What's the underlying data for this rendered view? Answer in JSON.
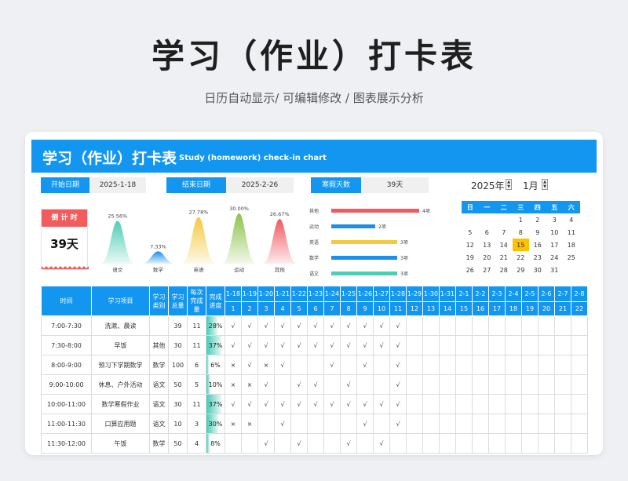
{
  "page": {
    "title": "学习（作业）打卡表",
    "subtitle": "日历自动显示/  可编辑修改  /  图表展示分析"
  },
  "sheet": {
    "title": "学习（作业）打卡表",
    "subtitle": "Study (homework) check-in chart",
    "start_label": "开始日期",
    "start_value": "2025-1-18",
    "end_label": "结束日期",
    "end_value": "2025-2-26",
    "days_label": "寒假天数",
    "days_value": "39天",
    "year": "2025年",
    "month": "1月",
    "spinner_up": "▲",
    "spinner_down": "▼"
  },
  "countdown": {
    "label": "倒 计 时",
    "value": "39天"
  },
  "colors": {
    "brand": "#1296f0",
    "accent_red": "#f25c5c",
    "today": "#ffc000",
    "progress": "#48cab8"
  },
  "chart_data": [
    {
      "type": "area",
      "categories": [
        "语文",
        "数学",
        "英语",
        "运动",
        "其他"
      ],
      "values": [
        25.56,
        7.33,
        27.78,
        30.0,
        26.67
      ],
      "value_labels": [
        "25.56%",
        "7.33%",
        "27.78%",
        "30.00%",
        "26.67%"
      ],
      "colors": [
        "#4ecdb5",
        "#1e8fe8",
        "#f5c842",
        "#8bc34a",
        "#f05a62"
      ],
      "ylim": [
        0,
        30
      ]
    },
    {
      "type": "bar",
      "orientation": "horizontal",
      "categories": [
        "其他",
        "运动",
        "英语",
        "数学",
        "语文"
      ],
      "values": [
        4,
        2,
        3,
        3,
        3
      ],
      "value_labels": [
        "4项",
        "2项",
        "3项",
        "3项",
        "3项"
      ],
      "colors": [
        "#f05a62",
        "#1e8fe8",
        "#f5c842",
        "#1e8fe8",
        "#4ecdb5"
      ],
      "xlim": [
        0,
        4
      ]
    }
  ],
  "calendar": {
    "weekdays": [
      "日",
      "一",
      "二",
      "三",
      "四",
      "五",
      "六"
    ],
    "weeks": [
      [
        "",
        "",
        "",
        "1",
        "2",
        "3",
        "4"
      ],
      [
        "5",
        "6",
        "7",
        "8",
        "9",
        "10",
        "11"
      ],
      [
        "12",
        "13",
        "14",
        "15",
        "16",
        "17",
        "18"
      ],
      [
        "19",
        "20",
        "21",
        "22",
        "23",
        "24",
        "25"
      ],
      [
        "26",
        "27",
        "28",
        "29",
        "30",
        "31",
        ""
      ]
    ],
    "today": "15"
  },
  "table": {
    "headers": {
      "time": "时间",
      "item": "学习项目",
      "category": "学习类别",
      "total": "学习总量",
      "daily": "每次完成量",
      "progress": "完成进度"
    },
    "dates": [
      "1-18",
      "1-19",
      "1-20",
      "1-21",
      "1-22",
      "1-23",
      "1-24",
      "1-25",
      "1-26",
      "1-27",
      "1-28",
      "1-29",
      "1-30",
      "1-31",
      "2-1",
      "2-2",
      "2-3",
      "2-4",
      "2-5",
      "2-6",
      "2-7",
      "2-8"
    ],
    "day_numbers": [
      "1",
      "2",
      "3",
      "4",
      "5",
      "6",
      "7",
      "8",
      "9",
      "10",
      "11",
      "12",
      "13",
      "14",
      "15",
      "16",
      "17",
      "18",
      "19",
      "20",
      "21",
      "22"
    ],
    "rows": [
      {
        "time": "7:00-7:30",
        "item": "洗漱、晨读",
        "category": "",
        "total": "39",
        "daily": "11",
        "progress": "28%",
        "pct": 28,
        "marks": [
          "√",
          "√",
          "√",
          "√",
          "√",
          "√",
          "√",
          "√",
          "√",
          "√",
          "√",
          "",
          "",
          "",
          "",
          "",
          "",
          "",
          "",
          "",
          "",
          ""
        ]
      },
      {
        "time": "7:30-8:00",
        "item": "早饭",
        "category": "其他",
        "total": "30",
        "daily": "11",
        "progress": "37%",
        "pct": 37,
        "marks": [
          "√",
          "√",
          "√",
          "√",
          "√",
          "√",
          "√",
          "√",
          "√",
          "√",
          "√",
          "",
          "",
          "",
          "",
          "",
          "",
          "",
          "",
          "",
          "",
          ""
        ]
      },
      {
        "time": "8:00-9:00",
        "item": "预习下学期数学",
        "category": "数学",
        "total": "100",
        "daily": "6",
        "progress": "6%",
        "pct": 6,
        "marks": [
          "×",
          "√",
          "×",
          "√",
          "",
          "",
          "√",
          "",
          "√",
          "",
          "√",
          "",
          "",
          "",
          "",
          "",
          "",
          "",
          "",
          "",
          "",
          ""
        ]
      },
      {
        "time": "9:00-10:00",
        "item": "休息、户外活动",
        "category": "语文",
        "total": "50",
        "daily": "5",
        "progress": "10%",
        "pct": 10,
        "marks": [
          "×",
          "×",
          "√",
          "",
          "√",
          "√",
          "",
          "√",
          "",
          "",
          "√",
          "",
          "",
          "",
          "",
          "",
          "",
          "",
          "",
          "",
          "",
          ""
        ]
      },
      {
        "time": "10:00-11:00",
        "item": "数学寒假作业",
        "category": "语文",
        "total": "30",
        "daily": "11",
        "progress": "37%",
        "pct": 37,
        "marks": [
          "√",
          "√",
          "√",
          "√",
          "√",
          "√",
          "√",
          "√",
          "√",
          "√",
          "√",
          "",
          "",
          "",
          "",
          "",
          "",
          "",
          "",
          "",
          "",
          ""
        ]
      },
      {
        "time": "11:00-11:30",
        "item": "口算应用题",
        "category": "语文",
        "total": "10",
        "daily": "3",
        "progress": "30%",
        "pct": 30,
        "marks": [
          "×",
          "×",
          "",
          "√",
          "",
          "",
          "",
          "",
          "√",
          "",
          "√",
          "",
          "",
          "",
          "",
          "",
          "",
          "",
          "",
          "",
          "",
          ""
        ]
      },
      {
        "time": "11:30-12:00",
        "item": "午饭",
        "category": "数学",
        "total": "50",
        "daily": "4",
        "progress": "8%",
        "pct": 8,
        "marks": [
          "",
          "",
          "√",
          "",
          "√",
          "",
          "",
          "√",
          "",
          "√",
          "",
          "",
          "",
          "",
          "",
          "",
          "",
          "",
          "",
          "",
          "",
          ""
        ]
      }
    ]
  }
}
